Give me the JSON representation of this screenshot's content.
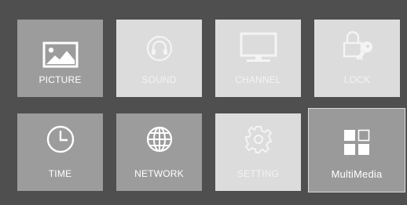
{
  "menu": {
    "tiles": [
      {
        "label": "PICTURE",
        "icon": "picture-icon",
        "state": "dark"
      },
      {
        "label": "SOUND",
        "icon": "sound-icon",
        "state": "light"
      },
      {
        "label": "CHANNEL",
        "icon": "channel-icon",
        "state": "light"
      },
      {
        "label": "LOCK",
        "icon": "lock-icon",
        "state": "light"
      },
      {
        "label": "TIME",
        "icon": "time-icon",
        "state": "dark"
      },
      {
        "label": "NETWORK",
        "icon": "network-icon",
        "state": "dark"
      },
      {
        "label": "SETTING",
        "icon": "setting-icon",
        "state": "light"
      },
      {
        "label": "MultiMedia",
        "icon": "multimedia-icon",
        "state": "selected"
      }
    ]
  },
  "colors": {
    "background": "#4f4f4f",
    "tile_dark": "#9c9c9c",
    "tile_light": "#dcdcdc",
    "tile_selected_border": "#d9d9d9"
  }
}
